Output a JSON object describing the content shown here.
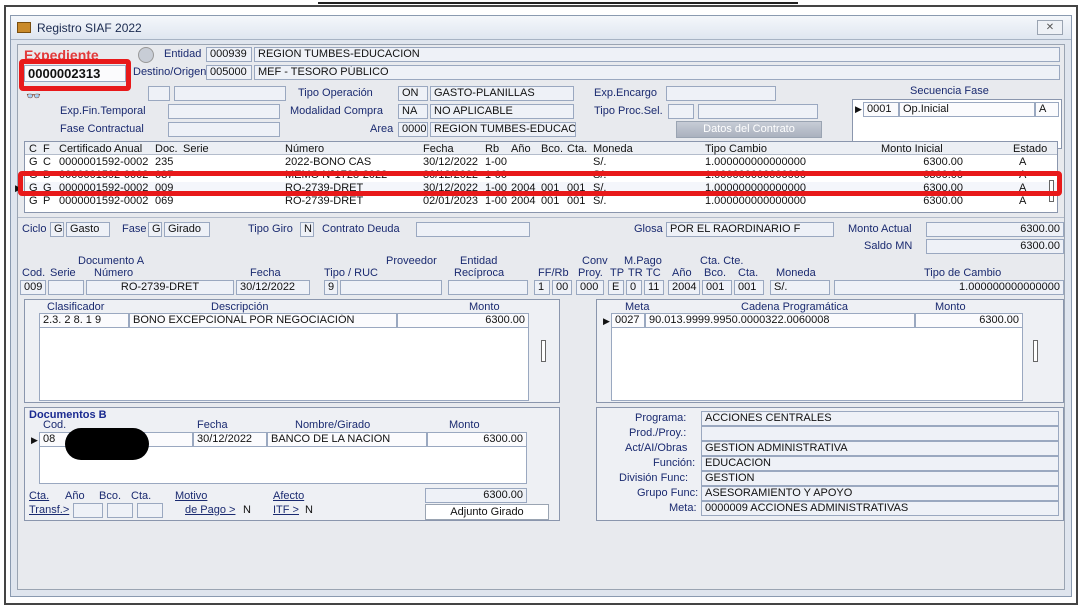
{
  "window": {
    "title": "Registro SIAF 2022"
  },
  "expediente": {
    "label": "Expediente",
    "number": "0000002313"
  },
  "entidad": {
    "label": "Entidad",
    "code": "000939",
    "name": "REGION TUMBES-EDUCACION"
  },
  "destino": {
    "label": "Destino/Origen",
    "code": "005000",
    "name": "MEF - TESORO PÚBLICO"
  },
  "tipo_operacion": {
    "label": "Tipo Operación",
    "code": "ON",
    "value": "GASTO-PLANILLAS"
  },
  "modalidad": {
    "label": "Modalidad Compra",
    "code": "NA",
    "value": "NO APLICABLE"
  },
  "area": {
    "label": "Area",
    "code": "0000",
    "value": "REGION TUMBES-EDUCACION"
  },
  "left_labels": {
    "exp_fin_temporal": "Exp.Fin.Temporal",
    "fase_contractual": "Fase Contractual"
  },
  "exp_encargo": {
    "label": "Exp.Encargo"
  },
  "tipo_proc_sel": {
    "label": "Tipo Proc.Sel."
  },
  "datos_contrato": {
    "label": "Datos del Contrato"
  },
  "secuencia": {
    "title": "Secuencia Fase",
    "code": "0001",
    "value": "Op.Inicial",
    "flag": "A"
  },
  "grid": {
    "headers": [
      "C",
      "F",
      "Certificado Anual",
      "Doc.",
      "Serie",
      "Número",
      "Fecha",
      "Rb",
      "Año",
      "Bco.",
      "Cta.",
      "Moneda",
      "Tipo Cambio",
      "Monto Inicial",
      "Estado"
    ],
    "rows": [
      [
        "G",
        "C",
        "0000001592-0002",
        "235",
        "",
        "2022-BONO CAS",
        "30/12/2022",
        "1-00",
        "",
        "",
        "",
        "S/.",
        "1.000000000000000",
        "6300.00",
        "A"
      ],
      [
        "G",
        "D",
        "0000001592-0002",
        "037",
        "",
        "MEMO N°1728-2022",
        "30/12/2022",
        "1-00",
        "",
        "",
        "",
        "S/.",
        "1.000000000000000",
        "6300.00",
        "A"
      ],
      [
        "G",
        "G",
        "0000001592-0002",
        "009",
        "",
        "RO-2739-DRET",
        "30/12/2022",
        "1-00",
        "2004",
        "001",
        "001",
        "S/.",
        "1.000000000000000",
        "6300.00",
        "A"
      ],
      [
        "G",
        "P",
        "0000001592-0002",
        "069",
        "",
        "RO-2739-DRET",
        "02/01/2023",
        "1-00",
        "2004",
        "001",
        "001",
        "S/.",
        "1.000000000000000",
        "6300.00",
        "A"
      ]
    ]
  },
  "ciclo": {
    "label": "Ciclo",
    "code": "G",
    "value": "Gasto"
  },
  "fase": {
    "label": "Fase",
    "code": "G",
    "value": "Girado"
  },
  "tipo_giro": {
    "label": "Tipo Giro",
    "code": "N"
  },
  "contrato_deuda": {
    "label": "Contrato Deuda"
  },
  "glosa": {
    "label": "Glosa",
    "value": "POR EL RAORDINARIO F"
  },
  "monto_actual": {
    "label": "Monto Actual",
    "value": "6300.00"
  },
  "saldo_mn": {
    "label": "Saldo MN",
    "value": "6300.00"
  },
  "documento_a": {
    "title": "Documento A",
    "cod_label": "Cod.",
    "serie_label": "Serie",
    "numero_label": "Número",
    "fecha_label": "Fecha",
    "cod": "009",
    "numero": "RO-2739-DRET",
    "fecha": "30/12/2022"
  },
  "proveedor": {
    "title": "Proveedor",
    "tipo_label": "Tipo / RUC",
    "tipo": "9"
  },
  "entidad_rec": {
    "title": "Entidad",
    "label": "Recíproca"
  },
  "ff_rb": {
    "label": "FF/Rb",
    "ff": "1",
    "rb": "00"
  },
  "conv": {
    "title": "Conv",
    "label": "Proy.",
    "value": "000"
  },
  "mpago": {
    "title": "M.Pago",
    "tp_label": "TP",
    "tr_label": "TR",
    "tc_label": "TC",
    "tp": "E",
    "tr": "0",
    "tc": "11"
  },
  "cta_cte": {
    "title": "Cta. Cte.",
    "anio_label": "Año",
    "bco_label": "Bco.",
    "cta_label": "Cta.",
    "anio": "2004",
    "bco": "001",
    "cta": "001"
  },
  "moneda": {
    "label": "Moneda",
    "value": "S/."
  },
  "tipo_cambio": {
    "label": "Tipo de Cambio",
    "value": "1.000000000000000"
  },
  "clasificador": {
    "h_clas": "Clasificador",
    "h_desc": "Descripción",
    "h_monto": "Monto",
    "code": "2.3. 2 8. 1 9",
    "desc": "BONO EXCEPCIONAL POR NEGOCIACIÓN",
    "monto": "6300.00"
  },
  "meta": {
    "h_meta": "Meta",
    "h_cadena": "Cadena Programática",
    "h_monto": "Monto",
    "code": "0027",
    "cadena": "90.013.9999.9950.0000322.0060008",
    "monto": "6300.00"
  },
  "documentos_b": {
    "title": "Documentos B",
    "cod_label": "Cod.",
    "fecha_label": "Fecha",
    "nombre_label": "Nombre/Girado",
    "monto_label": "Monto",
    "cod": "08",
    "fecha": "30/12/2022",
    "nombre": "BANCO DE LA NACION",
    "monto": "6300.00",
    "total": "6300.00"
  },
  "transf": {
    "cta_label": "Cta.",
    "transf_label": "Transf.>",
    "anio_label": "Año",
    "bco_label": "Bco.",
    "cta2_label": "Cta.",
    "motivo_label": "Motivo",
    "motivo_link": "de Pago >",
    "motivo_value": "N",
    "afecto_label": "Afecto",
    "itf_link": "ITF >",
    "itf_value": "N"
  },
  "adjunto": {
    "label": "Adjunto Girado"
  },
  "programa": {
    "programa_label": "Programa:",
    "programa": "ACCIONES CENTRALES",
    "prod_label": "Prod./Proy.:",
    "prod": "",
    "act_label": "Act/AI/Obras",
    "act": "GESTION ADMINISTRATIVA",
    "funcion_label": "Función:",
    "funcion": "EDUCACION",
    "division_label": "División Func:",
    "division": "GESTION",
    "grupo_label": "Grupo Func:",
    "grupo": "ASESORAMIENTO Y APOYO",
    "meta_label": "Meta:",
    "meta": "0000009  ACCIONES ADMINISTRATIVAS"
  },
  "colors": {
    "highlight": "#e8191a",
    "label_blue": "#1a2a70"
  }
}
